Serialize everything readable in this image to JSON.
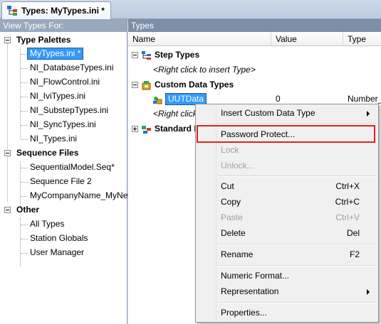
{
  "window": {
    "tab_title": "Types: MyTypes.ini *"
  },
  "left_pane": {
    "header": "View Types For:",
    "groups": [
      {
        "label": "Type Palettes",
        "items": [
          "MyTypes.ini *",
          "NI_DatabaseTypes.ini",
          "NI_FlowControl.ini",
          "NI_IviTypes.ini",
          "NI_SubstepTypes.ini",
          "NI_SyncTypes.ini",
          "NI_Types.ini"
        ]
      },
      {
        "label": "Sequence Files",
        "items": [
          "SequentialModel.Seq*",
          "Sequence File 2",
          "MyCompanyName_MyNewF"
        ]
      },
      {
        "label": "Other",
        "items": [
          "All Types",
          "Station Globals",
          "User Manager"
        ]
      }
    ]
  },
  "right_pane": {
    "header": "Types",
    "columns": [
      "Name",
      "Value",
      "Type"
    ],
    "rows": {
      "step_types": "Step Types",
      "step_hint": "<Right click to insert Type>",
      "custom_data_types": "Custom Data Types",
      "uutdata_name": "UUTData",
      "uutdata_value": "0",
      "uutdata_type": "Number_Ty",
      "custom_hint": "<Right click",
      "standard": "Standard I"
    }
  },
  "context_menu": {
    "items": [
      {
        "label": "Insert Custom Data Type",
        "shortcut": "",
        "submenu": true,
        "disabled": false
      },
      {
        "label": "Password Protect...",
        "shortcut": "",
        "submenu": false,
        "disabled": false,
        "highlighted": true
      },
      {
        "label": "Lock",
        "shortcut": "",
        "submenu": false,
        "disabled": true
      },
      {
        "label": "Unlock...",
        "shortcut": "",
        "submenu": false,
        "disabled": true
      },
      {
        "label": "Cut",
        "shortcut": "Ctrl+X",
        "submenu": false,
        "disabled": false
      },
      {
        "label": "Copy",
        "shortcut": "Ctrl+C",
        "submenu": false,
        "disabled": false
      },
      {
        "label": "Paste",
        "shortcut": "Ctrl+V",
        "submenu": false,
        "disabled": true
      },
      {
        "label": "Delete",
        "shortcut": "Del",
        "submenu": false,
        "disabled": false
      },
      {
        "label": "Rename",
        "shortcut": "F2",
        "submenu": false,
        "disabled": false
      },
      {
        "label": "Numeric Format...",
        "shortcut": "",
        "submenu": false,
        "disabled": false
      },
      {
        "label": "Representation",
        "shortcut": "",
        "submenu": true,
        "disabled": false
      },
      {
        "label": "Properties...",
        "shortcut": "",
        "submenu": false,
        "disabled": false
      }
    ],
    "highlight_color": "#e32020"
  },
  "colors": {
    "selection": "#3399ff",
    "pane_header": "#9aa8bf"
  },
  "icons": [
    "types-window-icon",
    "step-types-icon",
    "custom-data-types-icon",
    "container-icon",
    "standard-types-icon",
    "submenu-arrow-icon"
  ]
}
